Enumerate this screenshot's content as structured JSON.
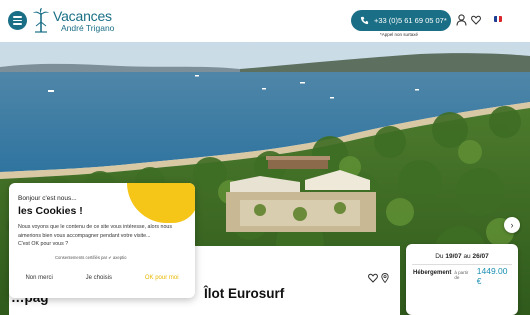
{
  "header": {
    "logo_line1": "Vacances",
    "logo_line2": "André Trigano",
    "phone": "+33 (0)5 61 69 05 07*",
    "phone_note": "*Appel non surtaxé"
  },
  "hero": {
    "prev_icon": "chevron-left-icon",
    "next_icon": "chevron-right-icon"
  },
  "cookie": {
    "hello": "Bonjour c'est nous...",
    "title": "les Cookies !",
    "body_line1": "Nous voyons que le contenu de ce site vous intéresse, alors nous",
    "body_line2": "aimerions bien vous accompagner pendant votre visite...",
    "body_line3": "C'est OK pour vous ?",
    "consent": "Consentements certifiés par ✔ axeptio",
    "no_label": "Non merci",
    "choose_label": "Je choisis",
    "ok_label": "OK pour moi"
  },
  "content": {
    "title_left": "…pag",
    "title_right": "Îlot Eurosurf"
  },
  "booking": {
    "dates_prefix": "Du",
    "date_from": "19/07",
    "dates_mid": "au",
    "date_to": "26/07",
    "label": "Hébergement",
    "from_text": "à partir de",
    "price": "1449.00 €"
  },
  "colors": {
    "brand": "#1a6f86",
    "accent_yellow": "#f5c518",
    "price_blue": "#1a8fb0"
  }
}
